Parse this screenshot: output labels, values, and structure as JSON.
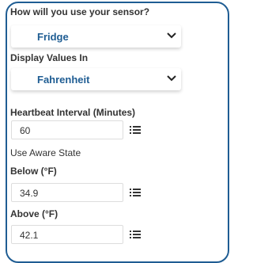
{
  "usage": {
    "question": "How will you use your sensor?",
    "selected": "Fridge"
  },
  "display_units": {
    "label": "Display Values In",
    "selected": "Fahrenheit"
  },
  "heartbeat": {
    "label": "Heartbeat Interval (Minutes)",
    "value": "60"
  },
  "aware_state": {
    "label": "Use Aware State"
  },
  "below": {
    "label": "Below (°F)",
    "value": "34.9"
  },
  "above": {
    "label": "Above (°F)",
    "value": "42.1"
  },
  "colors": {
    "accent": "#1f5d93",
    "text": "#333333",
    "border": "#dddddd"
  },
  "icons": {
    "dropdown": "chevron-down-icon",
    "options": "list-icon"
  }
}
